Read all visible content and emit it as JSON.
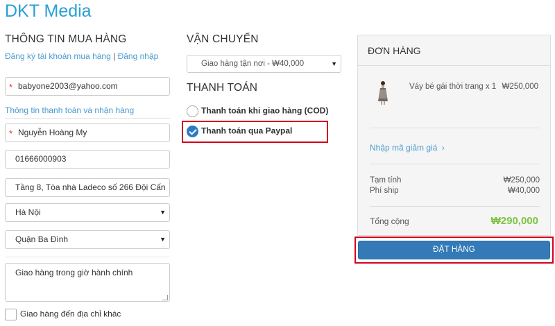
{
  "brand": {
    "name": "DKT Media"
  },
  "buyer": {
    "title": "THÔNG TIN MUA HÀNG",
    "register_link": "Đăng ký tài khoản mua hàng",
    "separator": "|",
    "login_link": "Đăng nhập",
    "email": "babyone2003@yahoo.com",
    "billing_label": "Thông tin thanh toán và nhận hàng",
    "full_name": "Nguyễn Hoàng My",
    "phone": "01666000903",
    "address": "Tầng 8, Tòa nhà Ladeco số 266 Đội Cấn",
    "city": "Hà Nội",
    "district": "Quận Ba Đình",
    "note": "Giao hàng trong giờ hành chính",
    "ship_other_label": "Giao hàng đến địa chỉ khác",
    "ship_other_checked": false
  },
  "shipping": {
    "title": "VẬN CHUYỂN",
    "selected": "Giao hàng tận nơi - ₩40,000"
  },
  "payment": {
    "title": "THANH TOÁN",
    "options": [
      {
        "label": "Thanh toán khi giao hàng (COD)",
        "checked": false
      },
      {
        "label": "Thanh toán qua Paypal",
        "checked": true
      }
    ]
  },
  "order": {
    "title": "ĐƠN HÀNG",
    "items": [
      {
        "name": "Váy bé gái thời trang x 1",
        "price": "₩250,000",
        "thumb_icon": "dress-thumbnail"
      }
    ],
    "coupon_link": "Nhập mã giảm giá",
    "subtotal_label": "Tạm tính",
    "subtotal_value": "₩250,000",
    "shipping_label": "Phí ship",
    "shipping_value": "₩40,000",
    "total_label": "Tổng cộng",
    "total_value": "₩290,000",
    "submit_label": "ĐẶT HÀNG"
  },
  "colors": {
    "brand": "#2a9fd6",
    "link": "#4a9bd1",
    "primary_button": "#337ab7",
    "total": "#7cc43f",
    "highlight_box": "#d0021b"
  }
}
